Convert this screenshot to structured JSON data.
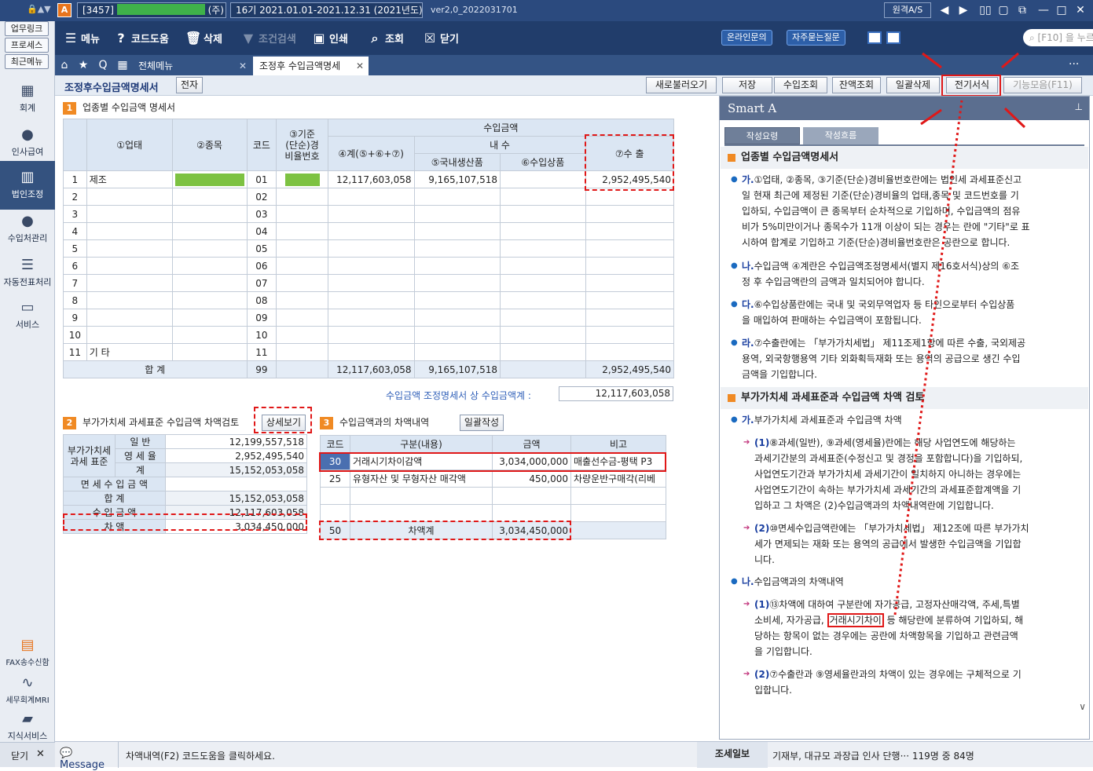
{
  "titlebar": {
    "company_code": "[3457]",
    "company_suffix": "(주)",
    "period": "16기 2021.01.01-2021.12.31 (2021년도)",
    "version": "ver2,0_2022031701",
    "remote_label": "원격A/S"
  },
  "leftbar": {
    "quick": [
      "업무링크",
      "프로세스",
      "최근메뉴"
    ],
    "items": [
      "회계",
      "인사급여",
      "법인조정",
      "수입처관리",
      "자동전표처리",
      "서비스"
    ],
    "bottom": [
      "FAX송수신함",
      "세무회계MRI",
      "지식서비스"
    ],
    "close": "닫기"
  },
  "toolbar": {
    "menu": "메뉴",
    "code_help": "코드도움",
    "delete": "삭제",
    "cond_search": "조건검색",
    "print": "인쇄",
    "inquiry": "조회",
    "close": "닫기",
    "online": "온라인문의",
    "faq": "자주묻는질문",
    "search_placeholder": "[F10] 을 누르세요"
  },
  "tabs": [
    "전체메뉴",
    "조정후 수입금액명세"
  ],
  "header": {
    "title": "조정후수입금액명세서",
    "e_label": "전자",
    "buttons": [
      "새로불러오기",
      "저장",
      "수입조회",
      "잔액조회",
      "일괄삭제",
      "전기서식",
      "기능모음(F11)"
    ]
  },
  "section1": {
    "num": "1",
    "title": "업종별 수입금액 명세서",
    "headers": {
      "biz": "①업태",
      "item": "②종목",
      "code": "코드",
      "std_l1": "③기준",
      "std_l2": "(단순)경",
      "std_l3": "비율번호",
      "income": "수입금액",
      "domestic": "내      수",
      "total": "④계(⑤+⑥+⑦)",
      "dom_prod": "⑤국내생산품",
      "import": "⑥수입상품",
      "export": "⑦수  출"
    },
    "rows": [
      {
        "n": "1",
        "biz": "제조",
        "code": "01",
        "total": "12,117,603,058",
        "dom": "9,165,107,518",
        "imp": "",
        "exp": "2,952,495,540"
      },
      {
        "n": "2",
        "biz": "",
        "code": "02",
        "total": "",
        "dom": "",
        "imp": "",
        "exp": ""
      },
      {
        "n": "3",
        "biz": "",
        "code": "03",
        "total": "",
        "dom": "",
        "imp": "",
        "exp": ""
      },
      {
        "n": "4",
        "biz": "",
        "code": "04",
        "total": "",
        "dom": "",
        "imp": "",
        "exp": ""
      },
      {
        "n": "5",
        "biz": "",
        "code": "05",
        "total": "",
        "dom": "",
        "imp": "",
        "exp": ""
      },
      {
        "n": "6",
        "biz": "",
        "code": "06",
        "total": "",
        "dom": "",
        "imp": "",
        "exp": ""
      },
      {
        "n": "7",
        "biz": "",
        "code": "07",
        "total": "",
        "dom": "",
        "imp": "",
        "exp": ""
      },
      {
        "n": "8",
        "biz": "",
        "code": "08",
        "total": "",
        "dom": "",
        "imp": "",
        "exp": ""
      },
      {
        "n": "9",
        "biz": "",
        "code": "09",
        "total": "",
        "dom": "",
        "imp": "",
        "exp": ""
      },
      {
        "n": "10",
        "biz": "",
        "code": "10",
        "total": "",
        "dom": "",
        "imp": "",
        "exp": ""
      },
      {
        "n": "11",
        "biz": "기    타",
        "code": "11",
        "total": "",
        "dom": "",
        "imp": "",
        "exp": ""
      }
    ],
    "sum": {
      "label": "합    계",
      "code": "99",
      "total": "12,117,603,058",
      "dom": "9,165,107,518",
      "imp": "",
      "exp": "2,952,495,540"
    },
    "adj_label": "수입금액 조정명세서 상 수입금액계 :",
    "adj_value": "12,117,603,058"
  },
  "section2": {
    "num": "2",
    "title": "부가가치세 과세표준 수입금액 차액검토",
    "detail_btn": "상세보기",
    "vat_l1": "부가가치세",
    "vat_l2": "과세 표준",
    "rows": [
      {
        "label": "일      반",
        "value": "12,199,557,518"
      },
      {
        "label": "영  세  율",
        "value": "2,952,495,540"
      },
      {
        "label": "계",
        "value": "15,152,053,058"
      }
    ],
    "exempt": {
      "label": "면 세 수 입 금 액",
      "value": ""
    },
    "sum": {
      "label": "합                  계",
      "value": "15,152,053,058"
    },
    "income": {
      "label": "수      입      금      액",
      "value": "12,117,603,058"
    },
    "diff": {
      "label": "차                  액",
      "value": "3,034,450,000"
    }
  },
  "section3": {
    "num": "3",
    "title": "수입금액과의 차액내역",
    "batch_btn": "일괄작성",
    "headers": [
      "코드",
      "구분(내용)",
      "금액",
      "비고"
    ],
    "rows": [
      {
        "code": "30",
        "desc": "거래시기차이감액",
        "amount": "3,034,000,000",
        "note": "매출선수금-평택 P3"
      },
      {
        "code": "25",
        "desc": "유형자산 및 무형자산 매각액",
        "amount": "450,000",
        "note": "차량운반구매각(리베"
      }
    ],
    "total": {
      "code": "50",
      "desc": "차액계",
      "amount": "3,034,450,000"
    }
  },
  "smart": {
    "title": "Smart A",
    "tab_active": "작성요령",
    "tab_other": "작성흐름",
    "h1": "업종별 수입금액명세서",
    "p_ga_k": "가.",
    "p_ga_lines": [
      "①업태, ②종목, ③기준(단순)경비율번호란에는 법인세 과세표준신고",
      "일 현재 최근에 제정된 기준(단순)경비율의 업태,종목 및 코드번호를 기",
      "입하되, 수입금액이 큰 종목부터 순차적으로 기입하며, 수입금액의 점유",
      "비가 5%미만이거나 종목수가 11개 이상이 되는 경우는 란에 \"기타\"로 표",
      "시하여 합계로 기입하고 기준(단순)경비율번호란은 공란으로 합니다."
    ],
    "p_na_k": "나.",
    "p_na_lines": [
      "수입금액 ④계란은 수입금액조정명세서(별지 제16호서식)상의 ⑥조",
      "정 후 수입금액란의 금액과 일치되어야 합니다."
    ],
    "p_da_k": "다.",
    "p_da_lines": [
      "⑥수입상품란에는 국내 및 국외무역업자 등 타인으로부터 수입상품",
      "을 매입하여 판매하는 수입금액이 포함됩니다."
    ],
    "p_ra_k": "라.",
    "p_ra_lines": [
      "⑦수출란에는 「부가가치세법」 제11조제1항에 따른 수출, 국외제공",
      "용역, 외국항행용역 기타 외화획득재화 또는 용역의 공급으로 생긴 수입",
      "금액을 기입합니다."
    ],
    "h2": "부가가치세 과세표준과 수입금액 차액 검토",
    "q_ga_k": "가.",
    "q_ga": "부가가치세 과세표준과 수입금액 차액",
    "s1_k": "(1)",
    "s1_lines": [
      "⑧과세(일반), ⑨과세(영세율)란에는 해당 사업연도에 해당하는",
      "과세기간분의 과세표준(수정신고 및 경정을 포함합니다)을 기입하되,",
      "사업연도기간과 부가가치세 과세기간이 일치하지 아니하는 경우에는",
      "사업연도기간이 속하는 부가가치세 과세기간의 과세표준합계액을 기",
      "입하고 그 차액은 (2)수입금액과의 차액내역란에 기입합니다."
    ],
    "s2_k": "(2)",
    "s2_lines": [
      "⑩면세수입금액란에는 「부가가치세법」 제12조에 따른 부가가치",
      "세가 면제되는 재화 또는 용역의 공급에서 발생한 수입금액을 기입합",
      "니다."
    ],
    "q_na_k": "나.",
    "q_na": "수입금액과의 차액내역",
    "t1_k": "(1)",
    "t1_l1": "⑬차액에 대하여 구분란에 자가공급, 고정자산매각액, 주세,특별",
    "t1_l2a": "소비세, 자가공급,",
    "t1_hl": "거래시기차이",
    "t1_l2b": "등 해당란에 분류하여 기입하되, 해",
    "t1_l3": "당하는 항목이 없는 경우에는 공란에 차액항목을 기입하고 관련금액",
    "t1_l4": "을 기입합니다.",
    "t2_k": "(2)",
    "t2_lines": [
      "⑦수출란과 ⑨영세율란과의 차액이 있는 경우에는 구체적으로 기",
      "입합니다."
    ]
  },
  "status": {
    "message_label": "Message",
    "message": "차액내역(F2) 코드도움을 클릭하세요.",
    "news_label": "조세일보",
    "news": "기재부, 대규모 과장급 인사 단행··· 119명 중 84명"
  }
}
